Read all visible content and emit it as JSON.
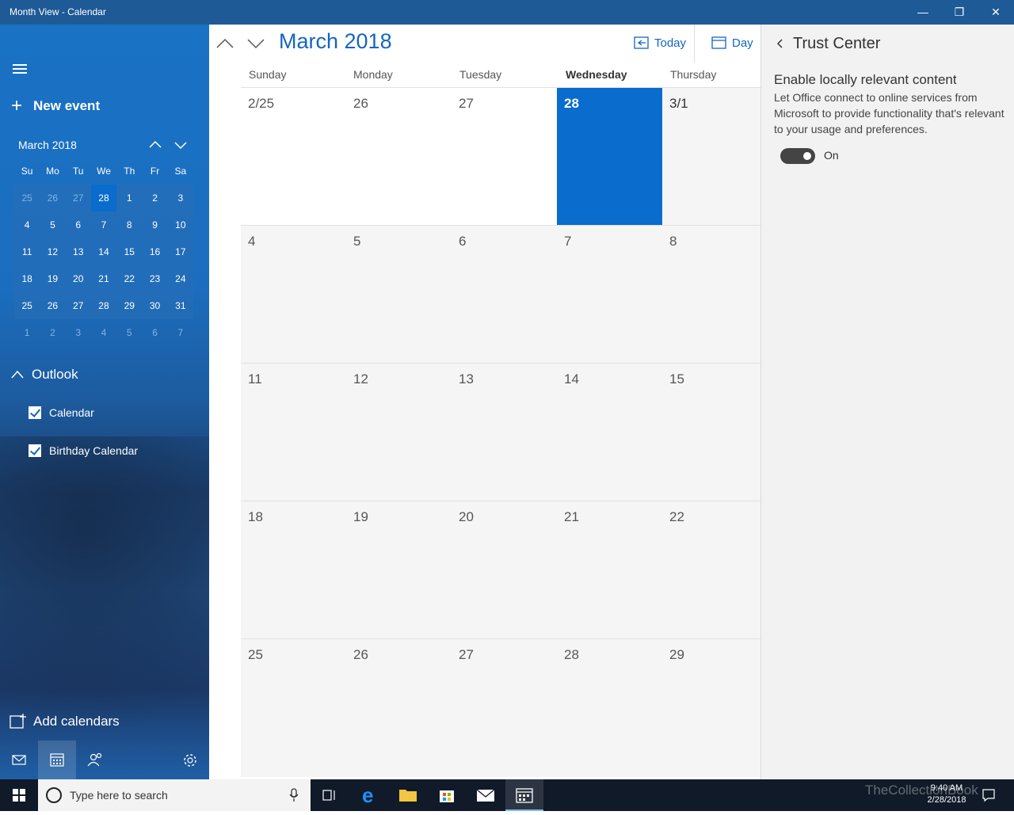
{
  "window": {
    "title": "Month View - Calendar",
    "minimize": "—",
    "restore": "❐",
    "close": "✕"
  },
  "sidebar": {
    "new_event": "New event",
    "mini_month": "March 2018",
    "weekdays": [
      "Su",
      "Mo",
      "Tu",
      "We",
      "Th",
      "Fr",
      "Sa"
    ],
    "weeks": [
      [
        "25",
        "26",
        "27",
        "28",
        "1",
        "2",
        "3"
      ],
      [
        "4",
        "5",
        "6",
        "7",
        "8",
        "9",
        "10"
      ],
      [
        "11",
        "12",
        "13",
        "14",
        "15",
        "16",
        "17"
      ],
      [
        "18",
        "19",
        "20",
        "21",
        "22",
        "23",
        "24"
      ],
      [
        "25",
        "26",
        "27",
        "28",
        "29",
        "30",
        "31"
      ],
      [
        "1",
        "2",
        "3",
        "4",
        "5",
        "6",
        "7"
      ]
    ],
    "account": "Outlook",
    "calendars": [
      "Calendar",
      "Birthday Calendar"
    ],
    "add_calendars": "Add calendars"
  },
  "main": {
    "month_title": "March 2018",
    "today_label": "Today",
    "view_label": "Day",
    "days_of_week": [
      "Sunday",
      "Monday",
      "Tuesday",
      "Wednesday",
      "Thursday"
    ],
    "weeks": [
      [
        "2/25",
        "26",
        "27",
        "28",
        "3/1"
      ],
      [
        "4",
        "5",
        "6",
        "7",
        "8"
      ],
      [
        "11",
        "12",
        "13",
        "14",
        "15"
      ],
      [
        "18",
        "19",
        "20",
        "21",
        "22"
      ],
      [
        "25",
        "26",
        "27",
        "28",
        "29"
      ]
    ]
  },
  "trust_center": {
    "title": "Trust Center",
    "setting_title": "Enable locally relevant content",
    "setting_desc": "Let Office connect to online services from Microsoft to provide functionality that's relevant to your usage and preferences.",
    "toggle_label": "On"
  },
  "taskbar": {
    "search_placeholder": "Type here to search",
    "time": "9:40 AM",
    "date": "2/28/2018",
    "watermark": "TheCollectionBook"
  },
  "colors": {
    "accent": "#0a6ccc",
    "titlebar": "#1e5a96",
    "taskbar": "#101a28"
  }
}
